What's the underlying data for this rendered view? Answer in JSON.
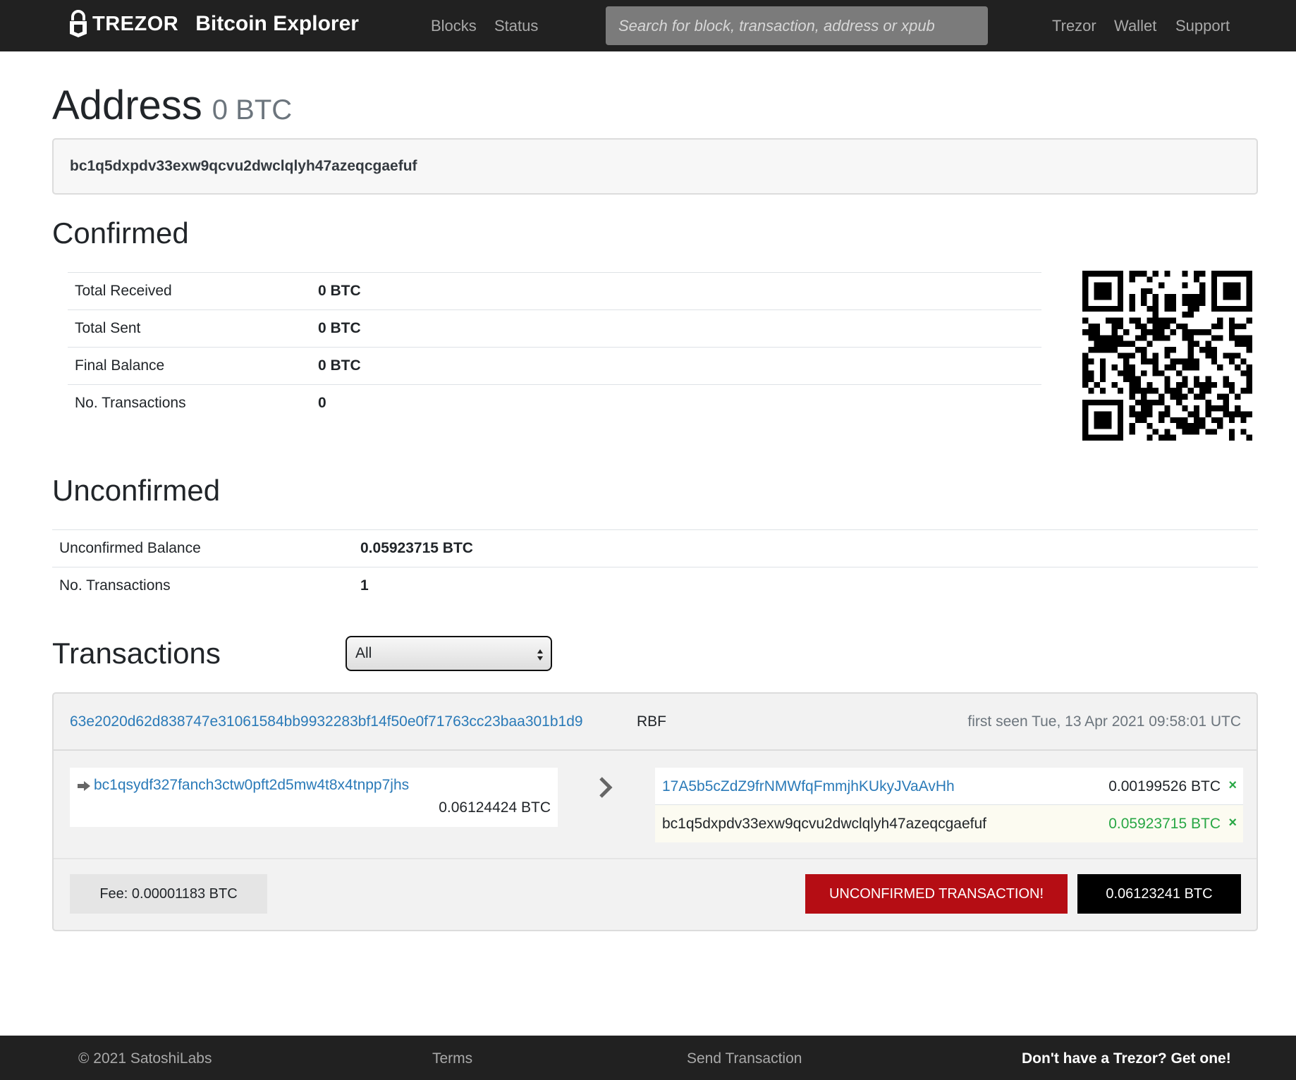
{
  "header": {
    "brand": "TREZOR",
    "app_title": "Bitcoin Explorer",
    "nav": {
      "blocks": "Blocks",
      "status": "Status"
    },
    "search_placeholder": "Search for block, transaction, address or xpub",
    "right_nav": {
      "trezor": "Trezor",
      "wallet": "Wallet",
      "support": "Support"
    }
  },
  "page": {
    "title": "Address",
    "title_balance": "0 BTC",
    "address": "bc1q5dxpdv33exw9qcvu2dwclqlyh47azeqcgaefuf"
  },
  "confirmed": {
    "heading": "Confirmed",
    "rows": [
      {
        "label": "Total Received",
        "value": "0 BTC"
      },
      {
        "label": "Total Sent",
        "value": "0 BTC"
      },
      {
        "label": "Final Balance",
        "value": "0 BTC"
      },
      {
        "label": "No. Transactions",
        "value": "0"
      }
    ]
  },
  "unconfirmed": {
    "heading": "Unconfirmed",
    "rows": [
      {
        "label": "Unconfirmed Balance",
        "value": "0.05923715 BTC"
      },
      {
        "label": "No. Transactions",
        "value": "1"
      }
    ]
  },
  "transactions": {
    "heading": "Transactions",
    "filter_selected": "All",
    "items": [
      {
        "txid": "63e2020d62d838747e31061584bb9932283bf14f50e0f71763cc23baa301b1d9",
        "flag": "RBF",
        "first_seen": "first seen Tue, 13 Apr 2021 09:58:01 UTC",
        "inputs": [
          {
            "address": "bc1qsydf327fanch3ctw0pft2d5mw4t8x4tnpp7jhs",
            "amount": "0.06124424 BTC"
          }
        ],
        "outputs": [
          {
            "address": "17A5b5cZdZ9frNMWfqFmmjhKUkyJVaAvHh",
            "amount": "0.00199526 BTC",
            "spent_mark": "×"
          },
          {
            "address": "bc1q5dxpdv33exw9qcvu2dwclqlyh47azeqcgaefuf",
            "amount": "0.05923715 BTC",
            "spent_mark": "×"
          }
        ],
        "fee": "Fee: 0.00001183 BTC",
        "status": "UNCONFIRMED TRANSACTION!",
        "total": "0.06123241 BTC"
      }
    ]
  },
  "footer": {
    "copyright": "© 2021 SatoshiLabs",
    "terms": "Terms",
    "send_transaction": "Send Transaction",
    "promo": "Don't have a Trezor? Get one!"
  },
  "icons": {
    "logo": "trezor-lock-icon",
    "input_arrow": "arrow-right-icon",
    "io_separator": "chevron-right-icon",
    "spent": "close-icon",
    "select": "select-arrows-icon",
    "qr": "qr-code"
  },
  "colors": {
    "navbar": "#212121",
    "link": "#2a7ab8",
    "unconfirmed_badge": "#b50d14",
    "total_badge": "#000000",
    "positive_amount": "#28a745"
  }
}
